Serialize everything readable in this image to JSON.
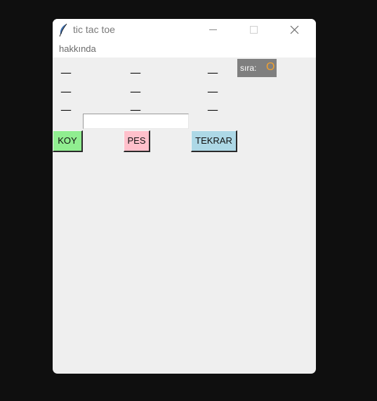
{
  "window": {
    "title": "tic tac toe"
  },
  "menu": {
    "items": [
      "hakkında"
    ]
  },
  "board": {
    "cells": [
      "—",
      "—",
      "—",
      "—",
      "—",
      "—",
      "—",
      "—",
      "—"
    ]
  },
  "turn": {
    "label": "sıra:",
    "value": "O"
  },
  "input": {
    "value": ""
  },
  "buttons": {
    "place": "KOY",
    "give_up": "PES",
    "restart": "TEKRAR"
  },
  "colors": {
    "place_button": "#90ee90",
    "give_up_button": "#ffc0cb",
    "restart_button": "#add8e6",
    "turn_value": "#f0a030"
  },
  "icons": {
    "app": "feather-icon",
    "minimize": "minimize-icon",
    "maximize": "maximize-icon",
    "close": "close-icon"
  }
}
